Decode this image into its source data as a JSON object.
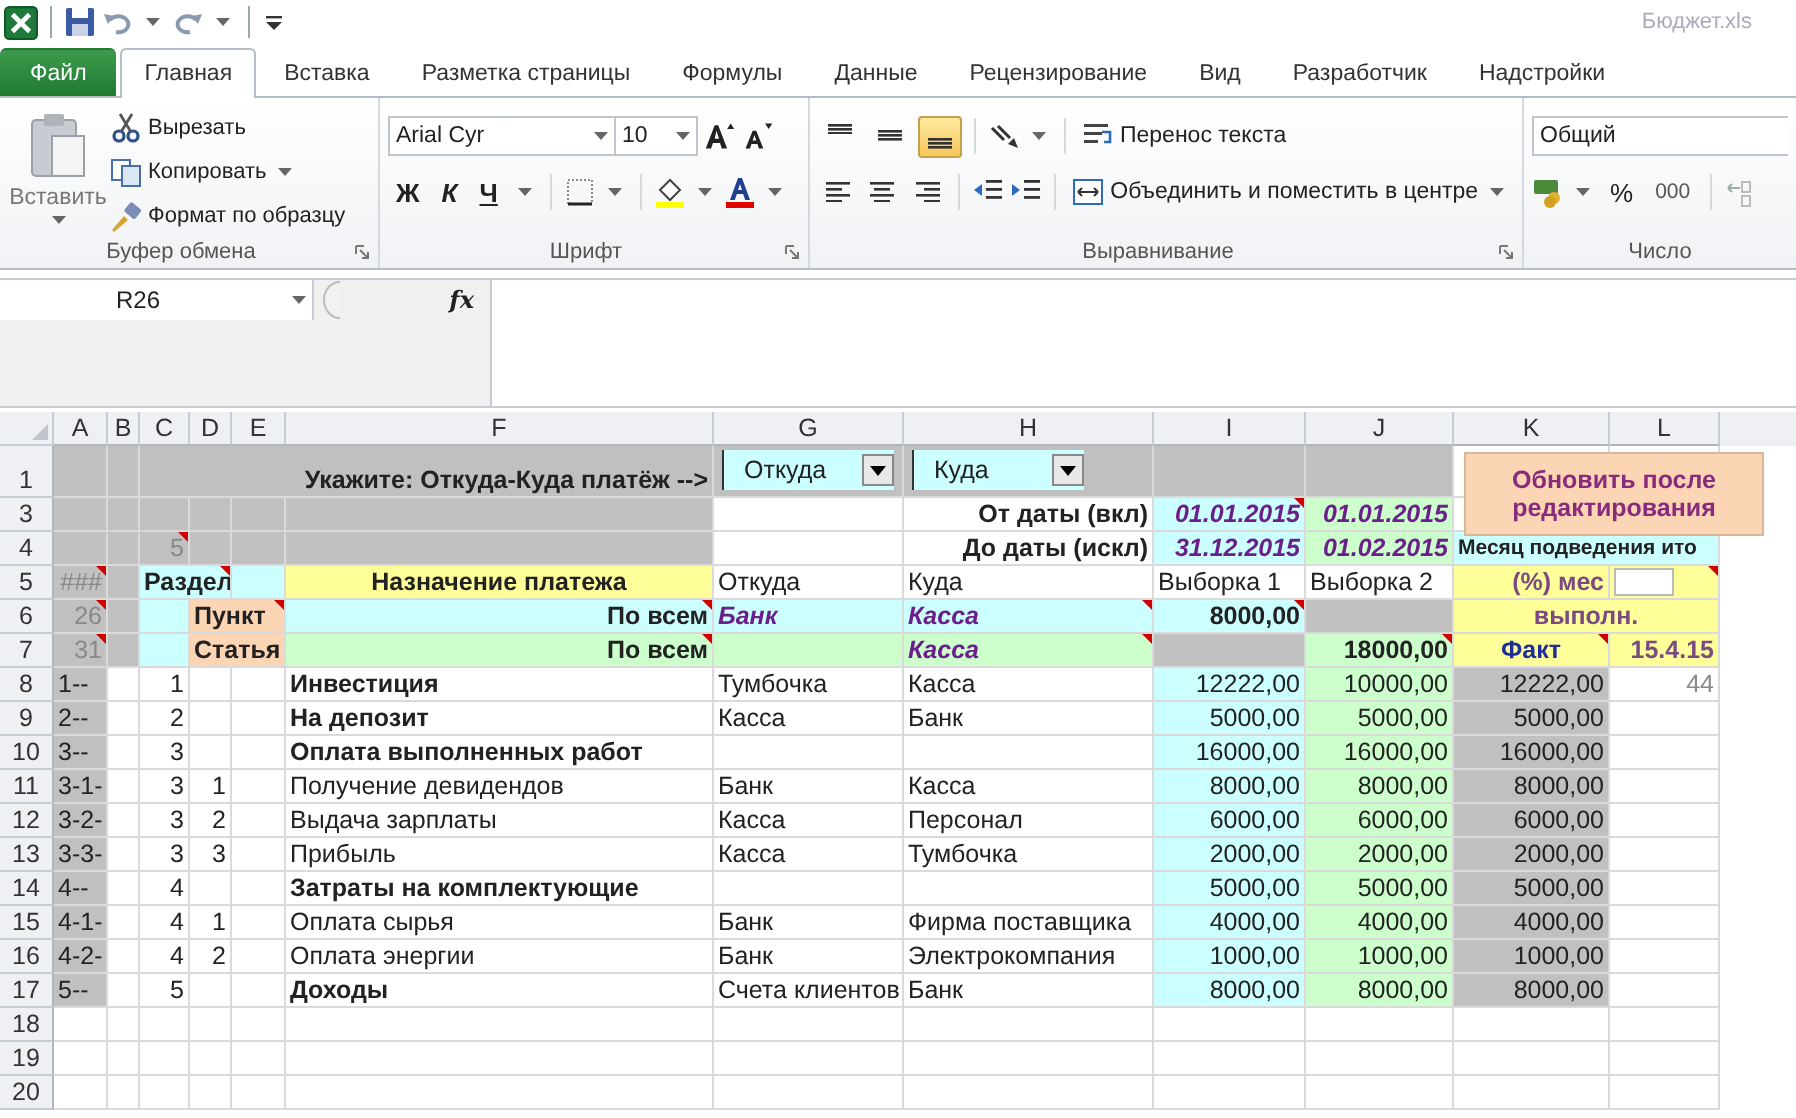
{
  "title": "Бюджет.xls",
  "tabs": [
    {
      "label": "Файл",
      "kind": "file",
      "selected": false
    },
    {
      "label": "Главная",
      "kind": "tab",
      "selected": true
    },
    {
      "label": "Вставка",
      "kind": "tab",
      "selected": false
    },
    {
      "label": "Разметка страницы",
      "kind": "tab",
      "selected": false
    },
    {
      "label": "Формулы",
      "kind": "tab",
      "selected": false
    },
    {
      "label": "Данные",
      "kind": "tab",
      "selected": false
    },
    {
      "label": "Рецензирование",
      "kind": "tab",
      "selected": false
    },
    {
      "label": "Вид",
      "kind": "tab",
      "selected": false
    },
    {
      "label": "Разработчик",
      "kind": "tab",
      "selected": false
    },
    {
      "label": "Надстройки",
      "kind": "tab",
      "selected": false
    }
  ],
  "clipboard": {
    "paste": "Вставить",
    "cut": "Вырезать",
    "copy": "Копировать",
    "format_painter": "Формат по образцу",
    "label": "Буфер обмена"
  },
  "font": {
    "name": "Arial Cyr",
    "size": "10",
    "bold": "Ж",
    "italic": "К",
    "underline": "Ч",
    "label": "Шрифт"
  },
  "alignment": {
    "vertical": [
      {
        "kind": "top",
        "selected": false
      },
      {
        "kind": "middle",
        "selected": false
      },
      {
        "kind": "bottom",
        "selected": true
      }
    ],
    "horizontal": [
      {
        "kind": "left",
        "selected": false
      },
      {
        "kind": "center",
        "selected": false
      },
      {
        "kind": "right",
        "selected": false
      }
    ],
    "wrap": "Перенос текста",
    "merge": "Объединить и поместить в центре",
    "label": "Выравнивание"
  },
  "number": {
    "format": "Общий",
    "percent": "%",
    "thousands": "000",
    "label": "Число"
  },
  "formula_bar": {
    "name_box": "R26",
    "function_label": "fx"
  },
  "sheet": {
    "columns": [
      "A",
      "B",
      "C",
      "D",
      "E",
      "F",
      "G",
      "H",
      "I",
      "J",
      "K",
      "L"
    ],
    "button": "Обновить после редактирования",
    "rows": [
      {
        "number": "1",
        "cells": [
          {},
          {},
          {
            "text": "Укажите: Откуда-Куда платёж -->",
            "kind": "right-bold"
          },
          {
            "merged": true
          },
          {
            "merged": true
          },
          {
            "merged": true
          },
          {
            "text": "Откуда",
            "kind": "combo"
          },
          {
            "text": "Куда",
            "kind": "combo"
          }
        ]
      },
      {
        "number": "3",
        "cells": [
          {},
          {},
          {},
          {},
          {},
          {},
          {},
          {
            "text": "От даты (вкл)",
            "kind": "right-bold"
          },
          {
            "text": "01.01.2015",
            "kind": "date",
            "note": true
          },
          {
            "text": "01.01.2015",
            "kind": "date"
          }
        ]
      },
      {
        "number": "4",
        "cells": [
          {},
          {},
          {
            "text": "5",
            "kind": "muted",
            "note": true
          },
          {},
          {},
          {},
          {},
          {
            "text": "До даты (искл)",
            "kind": "right-bold"
          },
          {
            "text": "31.12.2015",
            "kind": "date"
          },
          {
            "text": "01.02.2015",
            "kind": "date"
          },
          {
            "text": "Месяц подведения ито",
            "kind": "small-bold"
          },
          {
            "merged": true
          }
        ]
      },
      {
        "number": "5",
        "cells": [
          {
            "text": "###",
            "kind": "muted",
            "note": true
          },
          {},
          {
            "text": "Раздел",
            "kind": "header-left",
            "note": true
          },
          {
            "merged": true
          },
          {},
          {
            "text": "Назначение платежа",
            "kind": "header"
          },
          {
            "text": "Откуда",
            "kind": "text"
          },
          {
            "text": "Куда",
            "kind": "text"
          },
          {
            "text": "Выборка 1",
            "kind": "text"
          },
          {
            "text": "Выборка 2",
            "kind": "text"
          },
          {
            "text": "(%) мес",
            "kind": "accent"
          },
          {
            "kind": "box",
            "note": true
          }
        ]
      },
      {
        "number": "6",
        "cells": [
          {
            "text": "26",
            "kind": "muted",
            "note": true
          },
          {},
          {},
          {
            "text": "Пункт",
            "kind": "header-left",
            "note": true
          },
          {
            "merged": true
          },
          {
            "text": "По всем",
            "kind": "right-bold",
            "note": true
          },
          {
            "text": "Банк",
            "kind": "pick"
          },
          {
            "text": "Касса",
            "kind": "pick",
            "note": true
          },
          {
            "text": "8000,00",
            "kind": "num-bold",
            "note": true
          },
          {},
          {
            "text": "выполн.",
            "kind": "accent-center"
          },
          {
            "merged": true
          }
        ]
      },
      {
        "number": "7",
        "cells": [
          {
            "text": "31",
            "kind": "muted",
            "note": true
          },
          {},
          {},
          {
            "text": "Статья",
            "kind": "header-left"
          },
          {
            "merged": true
          },
          {
            "text": "По всем",
            "kind": "right-bold",
            "note": true
          },
          {},
          {
            "text": "Касса",
            "kind": "pick",
            "note": true
          },
          {},
          {
            "text": "18000,00",
            "kind": "num-bold",
            "note": true
          },
          {
            "text": "Факт",
            "kind": "fact",
            "note": true
          },
          {
            "text": "15.4.15",
            "kind": "accent"
          }
        ]
      },
      {
        "number": "8",
        "cells": [
          {
            "text": "1--",
            "kind": "text"
          },
          {},
          {
            "text": "1",
            "kind": "num"
          },
          {},
          {},
          {
            "text": "Инвестиция",
            "kind": "bold"
          },
          {
            "text": "Тумбочка",
            "kind": "text"
          },
          {
            "text": "Касса",
            "kind": "text"
          },
          {
            "text": "12222,00",
            "kind": "num"
          },
          {
            "text": "10000,00",
            "kind": "num"
          },
          {
            "text": "12222,00",
            "kind": "num"
          },
          {
            "text": "44",
            "kind": "muted"
          }
        ]
      },
      {
        "number": "9",
        "cells": [
          {
            "text": "2--",
            "kind": "text"
          },
          {},
          {
            "text": "2",
            "kind": "num"
          },
          {},
          {},
          {
            "text": "На депозит",
            "kind": "bold"
          },
          {
            "text": "Касса",
            "kind": "text"
          },
          {
            "text": "Банк",
            "kind": "text"
          },
          {
            "text": "5000,00",
            "kind": "num"
          },
          {
            "text": "5000,00",
            "kind": "num"
          },
          {
            "text": "5000,00",
            "kind": "num"
          }
        ]
      },
      {
        "number": "10",
        "cells": [
          {
            "text": "3--",
            "kind": "text"
          },
          {},
          {
            "text": "3",
            "kind": "num"
          },
          {},
          {},
          {
            "text": "Оплата выполненных работ",
            "kind": "bold"
          },
          {},
          {},
          {
            "text": "16000,00",
            "kind": "num"
          },
          {
            "text": "16000,00",
            "kind": "num"
          },
          {
            "text": "16000,00",
            "kind": "num"
          }
        ]
      },
      {
        "number": "11",
        "cells": [
          {
            "text": "3-1-",
            "kind": "text"
          },
          {},
          {
            "text": "3",
            "kind": "num"
          },
          {
            "text": "1",
            "kind": "num"
          },
          {},
          {
            "text": "Получение девидендов",
            "kind": "text"
          },
          {
            "text": "Банк",
            "kind": "text"
          },
          {
            "text": "Касса",
            "kind": "text"
          },
          {
            "text": "8000,00",
            "kind": "num"
          },
          {
            "text": "8000,00",
            "kind": "num"
          },
          {
            "text": "8000,00",
            "kind": "num"
          }
        ]
      },
      {
        "number": "12",
        "cells": [
          {
            "text": "3-2-",
            "kind": "text"
          },
          {},
          {
            "text": "3",
            "kind": "num"
          },
          {
            "text": "2",
            "kind": "num"
          },
          {},
          {
            "text": "Выдача зарплаты",
            "kind": "text"
          },
          {
            "text": "Касса",
            "kind": "text"
          },
          {
            "text": "Персонал",
            "kind": "text"
          },
          {
            "text": "6000,00",
            "kind": "num"
          },
          {
            "text": "6000,00",
            "kind": "num"
          },
          {
            "text": "6000,00",
            "kind": "num"
          }
        ]
      },
      {
        "number": "13",
        "cells": [
          {
            "text": "3-3-",
            "kind": "text"
          },
          {},
          {
            "text": "3",
            "kind": "num"
          },
          {
            "text": "3",
            "kind": "num"
          },
          {},
          {
            "text": "Прибыль",
            "kind": "text"
          },
          {
            "text": "Касса",
            "kind": "text"
          },
          {
            "text": "Тумбочка",
            "kind": "text"
          },
          {
            "text": "2000,00",
            "kind": "num"
          },
          {
            "text": "2000,00",
            "kind": "num"
          },
          {
            "text": "2000,00",
            "kind": "num"
          }
        ]
      },
      {
        "number": "14",
        "cells": [
          {
            "text": "4--",
            "kind": "text"
          },
          {},
          {
            "text": "4",
            "kind": "num"
          },
          {},
          {},
          {
            "text": "Затраты на комплектующие",
            "kind": "bold"
          },
          {},
          {},
          {
            "text": "5000,00",
            "kind": "num"
          },
          {
            "text": "5000,00",
            "kind": "num"
          },
          {
            "text": "5000,00",
            "kind": "num"
          }
        ]
      },
      {
        "number": "15",
        "cells": [
          {
            "text": "4-1-",
            "kind": "text"
          },
          {},
          {
            "text": "4",
            "kind": "num"
          },
          {
            "text": "1",
            "kind": "num"
          },
          {},
          {
            "text": "Оплата сырья",
            "kind": "text"
          },
          {
            "text": "Банк",
            "kind": "text"
          },
          {
            "text": "Фирма поставщика",
            "kind": "text"
          },
          {
            "text": "4000,00",
            "kind": "num"
          },
          {
            "text": "4000,00",
            "kind": "num"
          },
          {
            "text": "4000,00",
            "kind": "num"
          }
        ]
      },
      {
        "number": "16",
        "cells": [
          {
            "text": "4-2-",
            "kind": "text"
          },
          {},
          {
            "text": "4",
            "kind": "num"
          },
          {
            "text": "2",
            "kind": "num"
          },
          {},
          {
            "text": "Оплата энергии",
            "kind": "text"
          },
          {
            "text": "Банк",
            "kind": "text"
          },
          {
            "text": "Электрокомпания",
            "kind": "text"
          },
          {
            "text": "1000,00",
            "kind": "num"
          },
          {
            "text": "1000,00",
            "kind": "num"
          },
          {
            "text": "1000,00",
            "kind": "num"
          }
        ]
      },
      {
        "number": "17",
        "cells": [
          {
            "text": "5--",
            "kind": "text"
          },
          {},
          {
            "text": "5",
            "kind": "num"
          },
          {},
          {},
          {
            "text": "Доходы",
            "kind": "bold"
          },
          {
            "text": "Счета клиентов",
            "kind": "text"
          },
          {
            "text": "Банк",
            "kind": "text"
          },
          {
            "text": "8000,00",
            "kind": "num"
          },
          {
            "text": "8000,00",
            "kind": "num"
          },
          {
            "text": "8000,00",
            "kind": "num"
          }
        ]
      },
      {
        "number": "18"
      },
      {
        "number": "19"
      },
      {
        "number": "20"
      }
    ]
  }
}
